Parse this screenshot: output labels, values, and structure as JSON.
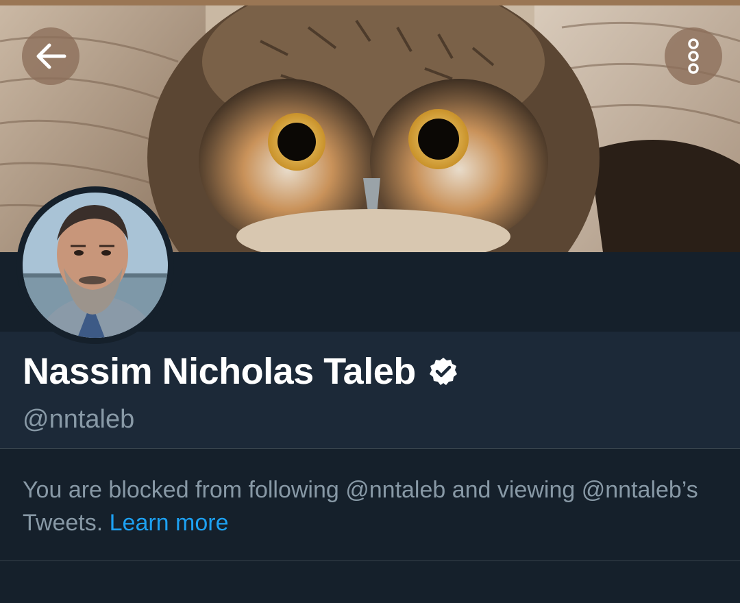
{
  "header": {
    "back_icon": "arrow-left-icon",
    "more_icon": "vertical-dots-icon",
    "banner_subject": "owl-photo"
  },
  "profile": {
    "name": "Nassim Nicholas Taleb",
    "handle": "@nntaleb",
    "verified_icon": "verified-badge-icon"
  },
  "blocked_notice": {
    "text": "You are blocked from following @nntaleb and viewing @nntaleb’s Tweets.",
    "link_label": "Learn more"
  },
  "colors": {
    "background": "#15202b",
    "info_background": "#1c2938",
    "name_text": "#ffffff",
    "secondary_text": "#8899a6",
    "link": "#1da1f2",
    "divider": "#38444d"
  }
}
